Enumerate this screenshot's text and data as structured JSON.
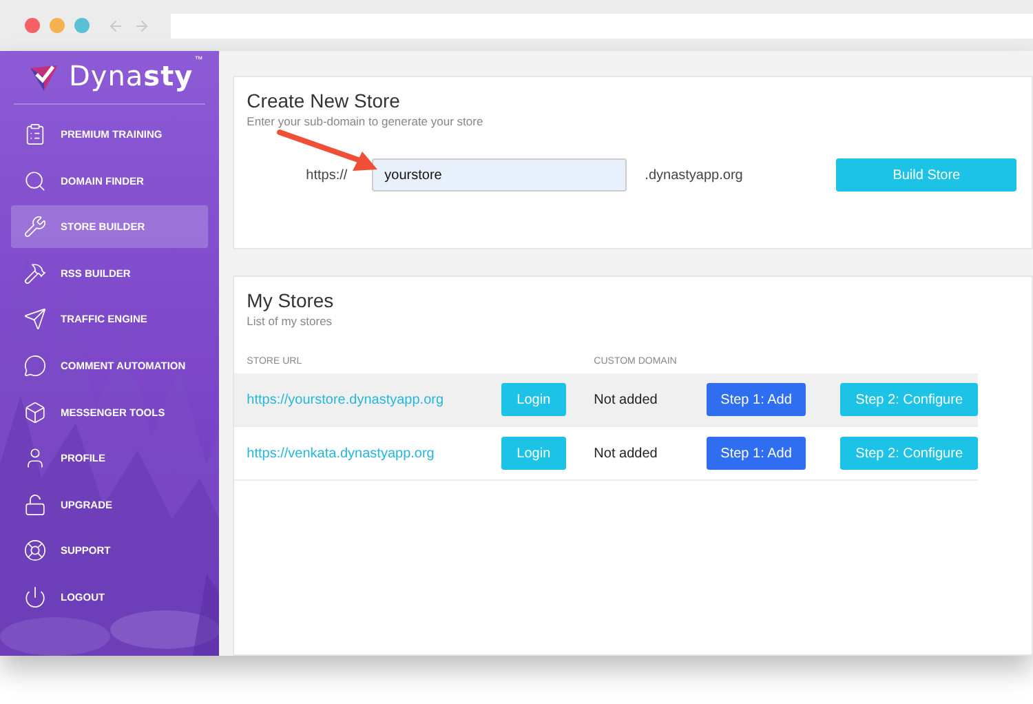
{
  "logo": {
    "text": "Dyna**sty**",
    "trademark": "™"
  },
  "sidebar": {
    "items": [
      {
        "label": "PREMIUM TRAINING",
        "selected": false
      },
      {
        "label": "DOMAIN FINDER",
        "selected": false
      },
      {
        "label": "STORE BUILDER",
        "selected": true
      },
      {
        "label": "RSS BUILDER",
        "selected": false
      },
      {
        "label": "TRAFFIC ENGINE",
        "selected": false
      },
      {
        "label": "COMMENT AUTOMATION",
        "selected": false
      },
      {
        "label": "MESSENGER TOOLS",
        "selected": false
      },
      {
        "label": "PROFILE",
        "selected": false
      },
      {
        "label": "UPGRADE",
        "selected": false
      },
      {
        "label": "SUPPORT",
        "selected": false
      },
      {
        "label": "LOGOUT",
        "selected": false
      }
    ]
  },
  "create_store": {
    "title": "Create New Store",
    "subtitle": "Enter your sub-domain to generate your store",
    "prefix": "https://",
    "value": "yourstore",
    "suffix": ".dynastyapp.org",
    "button": "Build Store"
  },
  "my_stores": {
    "title": "My Stores",
    "subtitle": "List of my stores",
    "columns": [
      "STORE URL",
      "CUSTOM DOMAIN"
    ],
    "rows": [
      {
        "url": "https://yourstore.dynastyapp.org",
        "login": "Login",
        "domain": "Not added",
        "step1": "Step 1: Add",
        "step2": "Step 2: Configure",
        "highlighted": true
      },
      {
        "url": "https://venkata.dynastyapp.org",
        "login": "Login",
        "domain": "Not added",
        "step1": "Step 1: Add",
        "step2": "Step 2: Configure",
        "highlighted": false
      }
    ]
  }
}
